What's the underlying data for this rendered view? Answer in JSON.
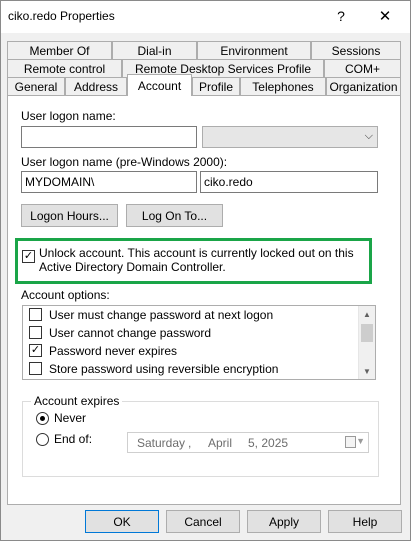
{
  "window": {
    "title": "ciko.redo Properties",
    "help_label": "?",
    "close_label": "✕"
  },
  "tabs": {
    "row1": [
      "Member Of",
      "Dial-in",
      "Environment",
      "Sessions"
    ],
    "row2": [
      "Remote control",
      "Remote Desktop Services Profile",
      "COM+"
    ],
    "row3": [
      "General",
      "Address",
      "Account",
      "Profile",
      "Telephones",
      "Organization"
    ],
    "active": "Account"
  },
  "account": {
    "logon_name_label": "User logon name:",
    "logon_name_value": "",
    "upn_suffix_value": "",
    "pre2000_label": "User logon name (pre-Windows 2000):",
    "pre2000_domain": "MYDOMAIN\\",
    "pre2000_user": "ciko.redo",
    "logon_hours_button": "Logon Hours...",
    "logon_to_button": "Log On To...",
    "unlock_checked": true,
    "unlock_label": "Unlock account. This account is currently locked out on this Active Directory Domain Controller.",
    "options_label": "Account options:",
    "options": [
      {
        "label": "User must change password at next logon",
        "checked": false
      },
      {
        "label": "User cannot change password",
        "checked": false
      },
      {
        "label": "Password never expires",
        "checked": true
      },
      {
        "label": "Store password using reversible encryption",
        "checked": false
      }
    ],
    "expires_title": "Account expires",
    "never_label": "Never",
    "never_selected": true,
    "end_of_label": "End of:",
    "date": {
      "weekday": "Saturday",
      "month": "April",
      "day_year": "5, 2025",
      "sep": ","
    }
  },
  "footer": {
    "ok": "OK",
    "cancel": "Cancel",
    "apply": "Apply",
    "help": "Help"
  },
  "colors": {
    "highlight": "#1aa548",
    "default_button_border": "#0078d7"
  },
  "icons": {
    "check": "✓",
    "dropdown": "chevron-down-icon",
    "calendar": "calendar-icon"
  }
}
